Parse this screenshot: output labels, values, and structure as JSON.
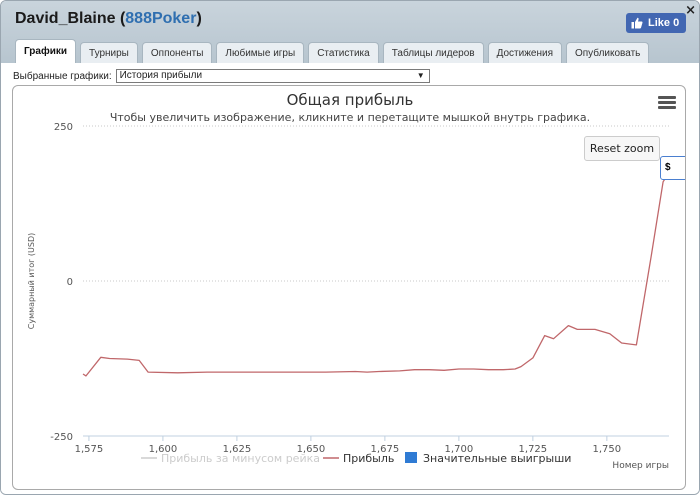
{
  "header": {
    "user": "David_Blaine",
    "site": "888Poker",
    "like_label": "Like 0",
    "close_label": "×"
  },
  "tabs": [
    {
      "label": "Графики"
    },
    {
      "label": "Турниры"
    },
    {
      "label": "Оппоненты"
    },
    {
      "label": "Любимые игры"
    },
    {
      "label": "Статистика"
    },
    {
      "label": "Таблицы лидеров"
    },
    {
      "label": "Достижения"
    },
    {
      "label": "Опубликовать"
    }
  ],
  "selector": {
    "label": "Выбранные графики:",
    "value": "История прибыли"
  },
  "chart_ui": {
    "reset_zoom": "Reset zoom",
    "tooltip": "$"
  },
  "colors": {
    "profit_line": "#c0676a",
    "rake_line": "#cccccc",
    "big_wins": "#2f7bd4",
    "fb_blue": "#4267b2"
  },
  "chart_data": {
    "type": "line",
    "title": "Общая прибыль",
    "subtitle": "Чтобы увеличить изображение, кликните и перетащите мышкой внутрь графика.",
    "xlabel": "Номер игры",
    "ylabel": "Суммарный итог (USD)",
    "xlim": [
      1573,
      1771
    ],
    "ylim": [
      -250,
      250
    ],
    "x_ticks": [
      "1,575",
      "1,600",
      "1,625",
      "1,650",
      "1,675",
      "1,700",
      "1,725",
      "1,750"
    ],
    "y_ticks": [
      "250",
      "0",
      "-250"
    ],
    "x_tick_values": [
      1575,
      1600,
      1625,
      1650,
      1675,
      1700,
      1725,
      1750
    ],
    "y_tick_values": [
      250,
      0,
      -250
    ],
    "legend": [
      {
        "label": "Прибыль за минусом рейка",
        "color": "#cccccc",
        "kind": "line",
        "disabled": true
      },
      {
        "label": "Прибыль",
        "color": "#c0676a",
        "kind": "line",
        "disabled": false
      },
      {
        "label": "Значительные выигрыши",
        "color": "#2f7bd4",
        "kind": "box",
        "disabled": false
      }
    ],
    "series": [
      {
        "name": "Прибыль",
        "x": [
          1573,
          1574,
          1579,
          1582,
          1588,
          1592,
          1595,
          1605,
          1615,
          1625,
          1635,
          1645,
          1655,
          1665,
          1669,
          1673,
          1680,
          1685,
          1690,
          1695,
          1700,
          1705,
          1710,
          1715,
          1719,
          1721,
          1725,
          1729,
          1732,
          1737,
          1740,
          1746,
          1751,
          1755,
          1760,
          1765,
          1769,
          1771
        ],
        "y": [
          -150,
          -153,
          -123,
          -125,
          -126,
          -128,
          -147,
          -148,
          -147,
          -147,
          -147,
          -147,
          -147,
          -146,
          -147,
          -146,
          -145,
          -143,
          -143,
          -144,
          -142,
          -142,
          -143,
          -143,
          -142,
          -138,
          -124,
          -88,
          -93,
          -72,
          -78,
          -78,
          -85,
          -100,
          -103,
          40,
          160,
          175
        ]
      }
    ]
  }
}
